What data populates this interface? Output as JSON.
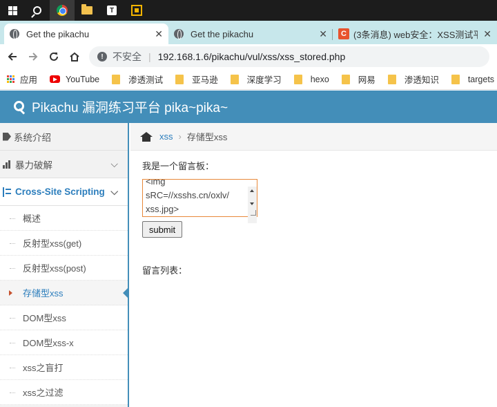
{
  "browser": {
    "tabs": [
      {
        "title": "Get the pikachu",
        "close": "✕"
      },
      {
        "title": "Get the pikachu",
        "close": "✕"
      },
      {
        "title": "(3条消息) web安全：XSS测试平",
        "close": "✕",
        "favicon_text": "C"
      }
    ],
    "security_label": "不安全",
    "url": "192.168.1.6/pikachu/vul/xss/xss_stored.php",
    "icons": {
      "back": "arrow-left-icon",
      "forward": "arrow-right-icon",
      "reload": "reload-icon",
      "home": "home-icon",
      "insecure": "info-icon"
    }
  },
  "bookmarks": [
    {
      "label": "应用",
      "icon": "apps-grid-icon"
    },
    {
      "label": "YouTube",
      "icon": "youtube-icon"
    },
    {
      "label": "渗透测试",
      "icon": "folder-icon"
    },
    {
      "label": "亚马逊",
      "icon": "folder-icon"
    },
    {
      "label": "深度学习",
      "icon": "folder-icon"
    },
    {
      "label": "hexo",
      "icon": "folder-icon"
    },
    {
      "label": "网易",
      "icon": "folder-icon"
    },
    {
      "label": "渗透知识",
      "icon": "folder-icon"
    },
    {
      "label": "targets",
      "icon": "folder-icon"
    }
  ],
  "header": {
    "title": "Pikachu 漏洞练习平台 pika~pika~",
    "accent": "#438eb9"
  },
  "sidebar": {
    "sections": [
      {
        "label": "系统介绍",
        "icon": "tag-icon"
      },
      {
        "label": "暴力破解",
        "icon": "bar-chart-icon",
        "chevron": "⌵"
      },
      {
        "label": "Cross-Site Scripting",
        "icon": "sitemap-icon",
        "chevron": "⌵"
      }
    ],
    "items": [
      {
        "label": "概述"
      },
      {
        "label": "反射型xss(get)"
      },
      {
        "label": "反射型xss(post)"
      },
      {
        "label": "存储型xss"
      },
      {
        "label": "DOM型xss"
      },
      {
        "label": "DOM型xss-x"
      },
      {
        "label": "xss之盲打"
      },
      {
        "label": "xss之过滤"
      }
    ]
  },
  "breadcrumb": {
    "parent": "xss",
    "sep": "›",
    "current": "存储型xss"
  },
  "main": {
    "board_label": "我是一个留言板：",
    "message_value": "<img\nsRC=//xsshs.cn/oxlv/\nxss.jpg>",
    "submit_label": "submit",
    "list_label": "留言列表："
  }
}
